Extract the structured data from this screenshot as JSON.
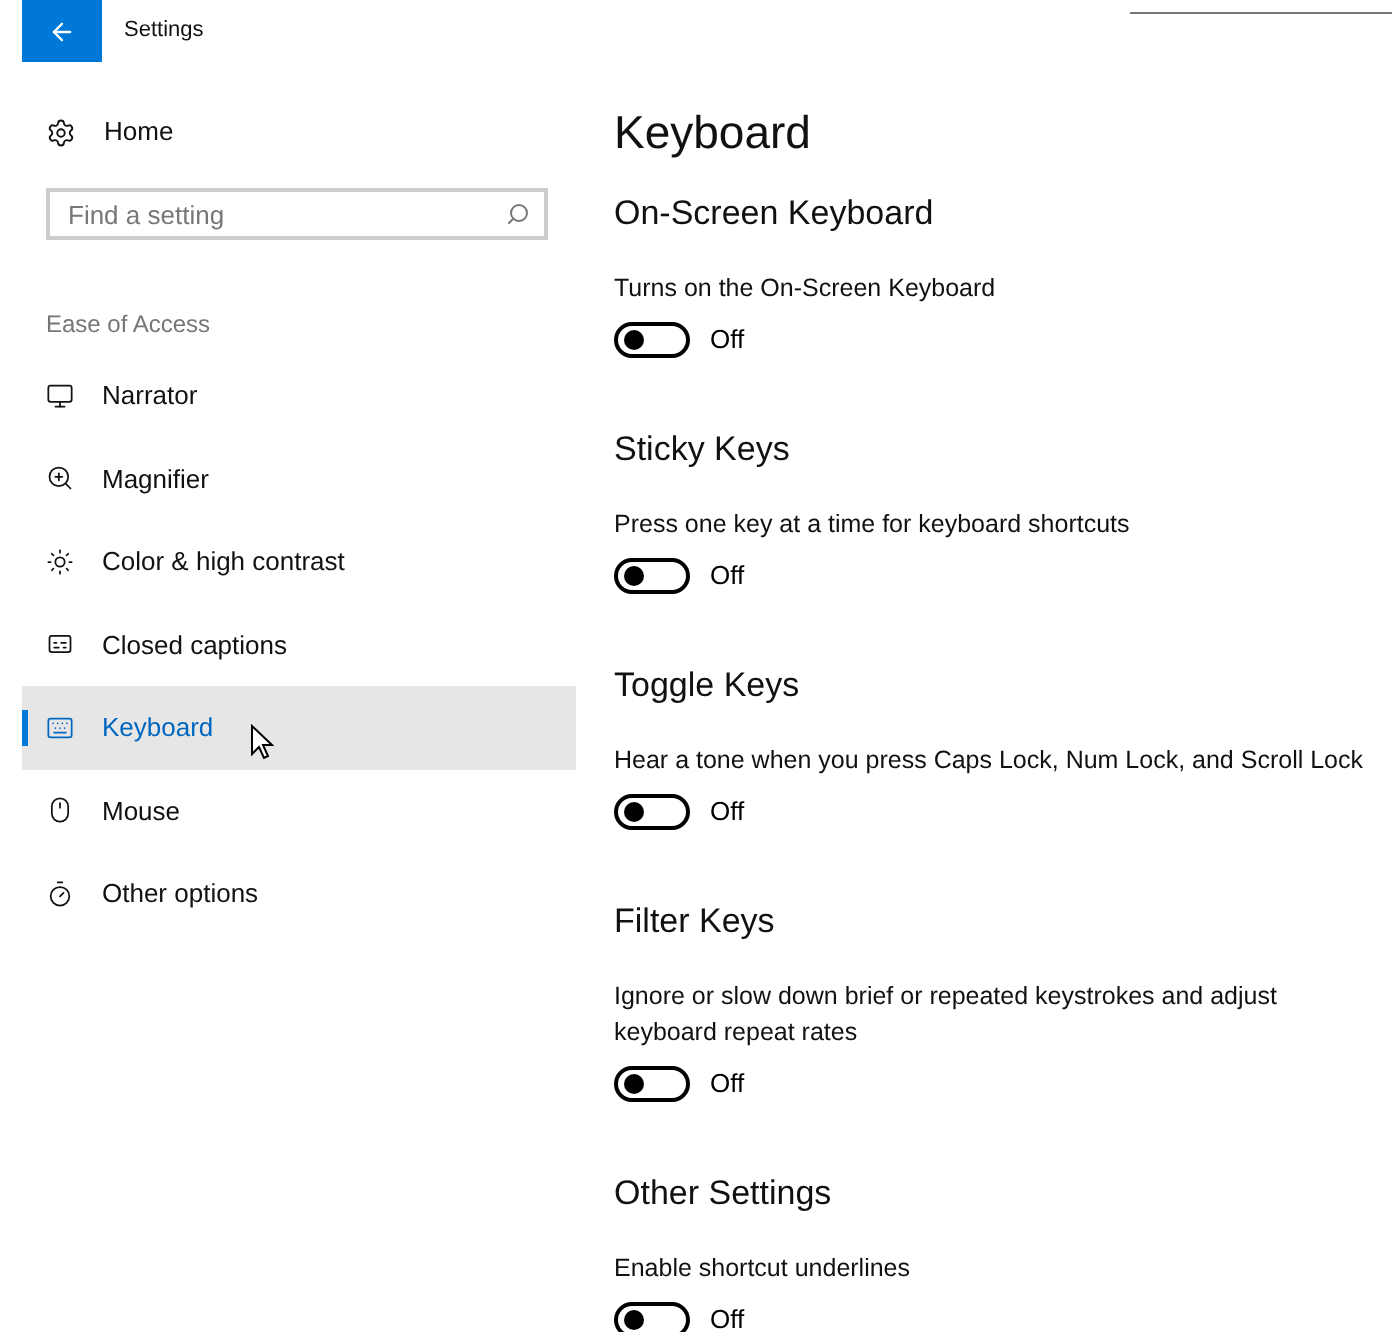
{
  "window": {
    "title": "Settings"
  },
  "sidebar": {
    "home": "Home",
    "search": {
      "placeholder": "Find a setting"
    },
    "group": "Ease of Access",
    "items": [
      {
        "label": "Narrator",
        "selected": false
      },
      {
        "label": "Magnifier",
        "selected": false
      },
      {
        "label": "Color & high contrast",
        "selected": false
      },
      {
        "label": "Closed captions",
        "selected": false
      },
      {
        "label": "Keyboard",
        "selected": true
      },
      {
        "label": "Mouse",
        "selected": false
      },
      {
        "label": "Other options",
        "selected": false
      }
    ]
  },
  "page": {
    "title": "Keyboard",
    "sections": [
      {
        "title": "On-Screen Keyboard",
        "description": "Turns on the On-Screen Keyboard",
        "toggle": {
          "on": false,
          "label": "Off"
        }
      },
      {
        "title": "Sticky Keys",
        "description": "Press one key at a time for keyboard shortcuts",
        "toggle": {
          "on": false,
          "label": "Off"
        }
      },
      {
        "title": "Toggle Keys",
        "description": "Hear a tone when you press Caps Lock, Num Lock, and Scroll Lock",
        "toggle": {
          "on": false,
          "label": "Off"
        }
      },
      {
        "title": "Filter Keys",
        "description": "Ignore or slow down brief or repeated keystrokes and adjust keyboard repeat rates",
        "toggle": {
          "on": false,
          "label": "Off"
        }
      },
      {
        "title": "Other Settings",
        "description": "Enable shortcut underlines",
        "toggle": {
          "on": false,
          "label": "Off"
        }
      }
    ]
  }
}
